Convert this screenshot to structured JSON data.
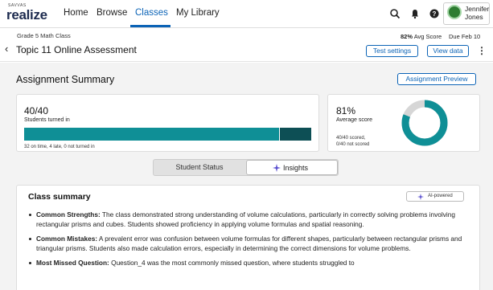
{
  "nav": {
    "logo_small": "SAVVAS",
    "logo": "realize",
    "links": [
      "Home",
      "Browse",
      "Classes",
      "My Library"
    ],
    "active": "Classes",
    "user_first": "Jennifer",
    "user_last": "Jones"
  },
  "header": {
    "breadcrumb": "Grade 5 Math Class",
    "title": "Topic 11 Online Assessment",
    "avg_score": "82%",
    "avg_label": "Avg Score",
    "due": "Due Feb 10",
    "test_settings": "Test settings",
    "view_data": "View data"
  },
  "summary": {
    "title": "Assignment Summary",
    "preview_button": "Assignment Preview",
    "turned_in_count": "40/40",
    "turned_in_label": "Students turned in",
    "turned_in_detail": "32 on time, 4 late, 0 not turned in",
    "on_time": 32,
    "late": 4,
    "not_turned_in": 0,
    "avg_pct": "81%",
    "avg_label": "Average score",
    "avg_value": 0.81,
    "scored": "40/40 scored,",
    "not_scored": "0/40 not scored"
  },
  "tabs": {
    "status": "Student Status",
    "insights": "Insights"
  },
  "class_summary": {
    "title": "Class summary",
    "badge": "AI-powered",
    "items": [
      {
        "label": "Common Strengths:",
        "text": " The class demonstrated strong understanding of volume calculations, particularly in correctly solving problems involving rectangular prisms and cubes. Students showed proficiency in applying volume formulas and spatial reasoning."
      },
      {
        "label": "Common Mistakes:",
        "text": " A prevalent error was confusion between volume formulas for different shapes, particularly between rectangular prisms and triangular prisms. Students also made calculation errors, especially in determining the correct dimensions for volume problems."
      },
      {
        "label": "Most Missed Question:",
        "text": " Question_4 was the most commonly missed question, where students struggled to"
      }
    ]
  },
  "colors": {
    "accent": "#0b63b6",
    "teal": "#0f8f96",
    "teal_dark": "#0d4f55",
    "ring_track": "#d6d6d6"
  }
}
